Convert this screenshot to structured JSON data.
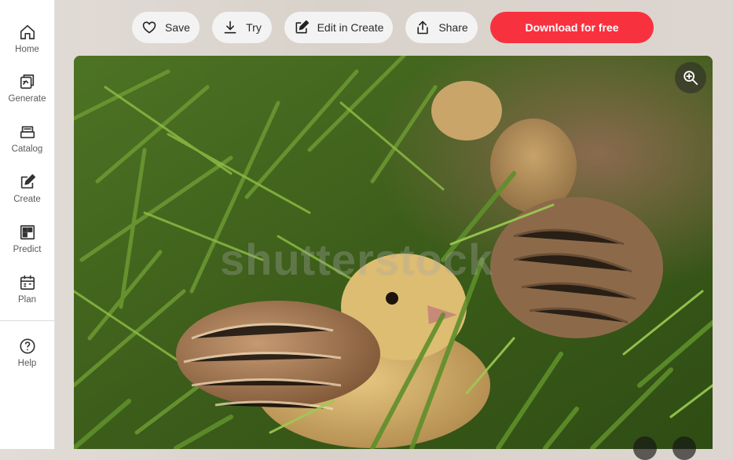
{
  "sidebar": {
    "items": [
      {
        "label": "Home",
        "icon": "home-icon"
      },
      {
        "label": "Generate",
        "icon": "generate-icon"
      },
      {
        "label": "Catalog",
        "icon": "catalog-icon"
      },
      {
        "label": "Create",
        "icon": "create-icon"
      },
      {
        "label": "Predict",
        "icon": "predict-icon"
      },
      {
        "label": "Plan",
        "icon": "plan-icon"
      }
    ],
    "help": {
      "label": "Help",
      "icon": "help-icon"
    }
  },
  "toolbar": {
    "save_label": "Save",
    "try_label": "Try",
    "edit_label": "Edit in Create",
    "share_label": "Share",
    "download_label": "Download for free"
  },
  "image": {
    "watermark": "shutterstock",
    "subject": "peafowl chicks in grass"
  },
  "colors": {
    "accent": "#f8313f",
    "sidebar_bg": "#ffffff",
    "button_bg": "#f3f3f3"
  }
}
